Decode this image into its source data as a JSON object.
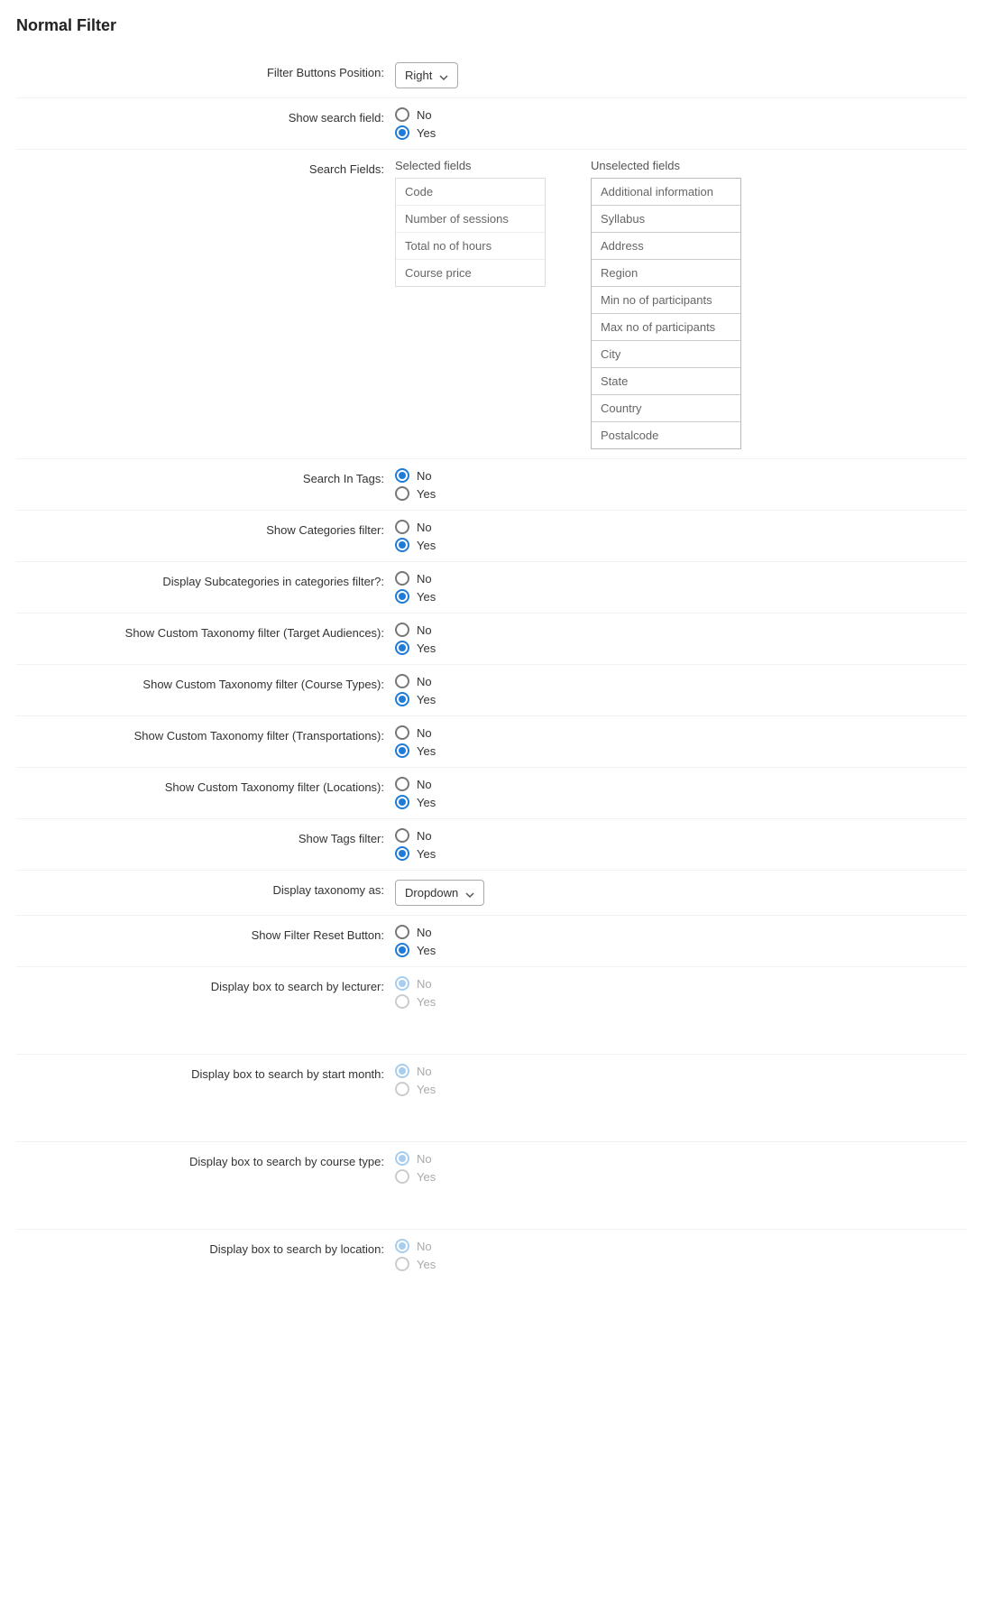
{
  "section_title": "Normal Filter",
  "options": {
    "no": "No",
    "yes": "Yes"
  },
  "filter_buttons_position": {
    "label": "Filter Buttons Position:",
    "value": "Right"
  },
  "show_search_field": {
    "label": "Show search field:",
    "value": "yes"
  },
  "search_fields": {
    "label": "Search Fields:",
    "selected_header": "Selected fields",
    "unselected_header": "Unselected fields",
    "selected": [
      "Code",
      "Number of sessions",
      "Total no of hours",
      "Course price"
    ],
    "unselected": [
      "Additional information",
      "Syllabus",
      "Address",
      "Region",
      "Min no of participants",
      "Max no of participants",
      "City",
      "State",
      "Country",
      "Postalcode"
    ]
  },
  "search_in_tags": {
    "label": "Search In Tags:",
    "value": "no"
  },
  "show_categories_filter": {
    "label": "Show Categories filter:",
    "value": "yes"
  },
  "display_subcategories": {
    "label": "Display Subcategories in categories filter?:",
    "value": "yes"
  },
  "show_taxonomy_target_audiences": {
    "label": "Show Custom Taxonomy filter (Target Audiences):",
    "value": "yes"
  },
  "show_taxonomy_course_types": {
    "label": "Show Custom Taxonomy filter (Course Types):",
    "value": "yes"
  },
  "show_taxonomy_transportations": {
    "label": "Show Custom Taxonomy filter (Transportations):",
    "value": "yes"
  },
  "show_taxonomy_locations": {
    "label": "Show Custom Taxonomy filter (Locations):",
    "value": "yes"
  },
  "show_tags_filter": {
    "label": "Show Tags filter:",
    "value": "yes"
  },
  "display_taxonomy_as": {
    "label": "Display taxonomy as:",
    "value": "Dropdown"
  },
  "show_filter_reset_button": {
    "label": "Show Filter Reset Button:",
    "value": "yes"
  },
  "display_box_lecturer": {
    "label": "Display box to search by lecturer:",
    "value": "no",
    "disabled": true
  },
  "display_box_start_month": {
    "label": "Display box to search by start month:",
    "value": "no",
    "disabled": true
  },
  "display_box_course_type": {
    "label": "Display box to search by course type:",
    "value": "no",
    "disabled": true
  },
  "display_box_location": {
    "label": "Display box to search by location:",
    "value": "no",
    "disabled": true
  }
}
